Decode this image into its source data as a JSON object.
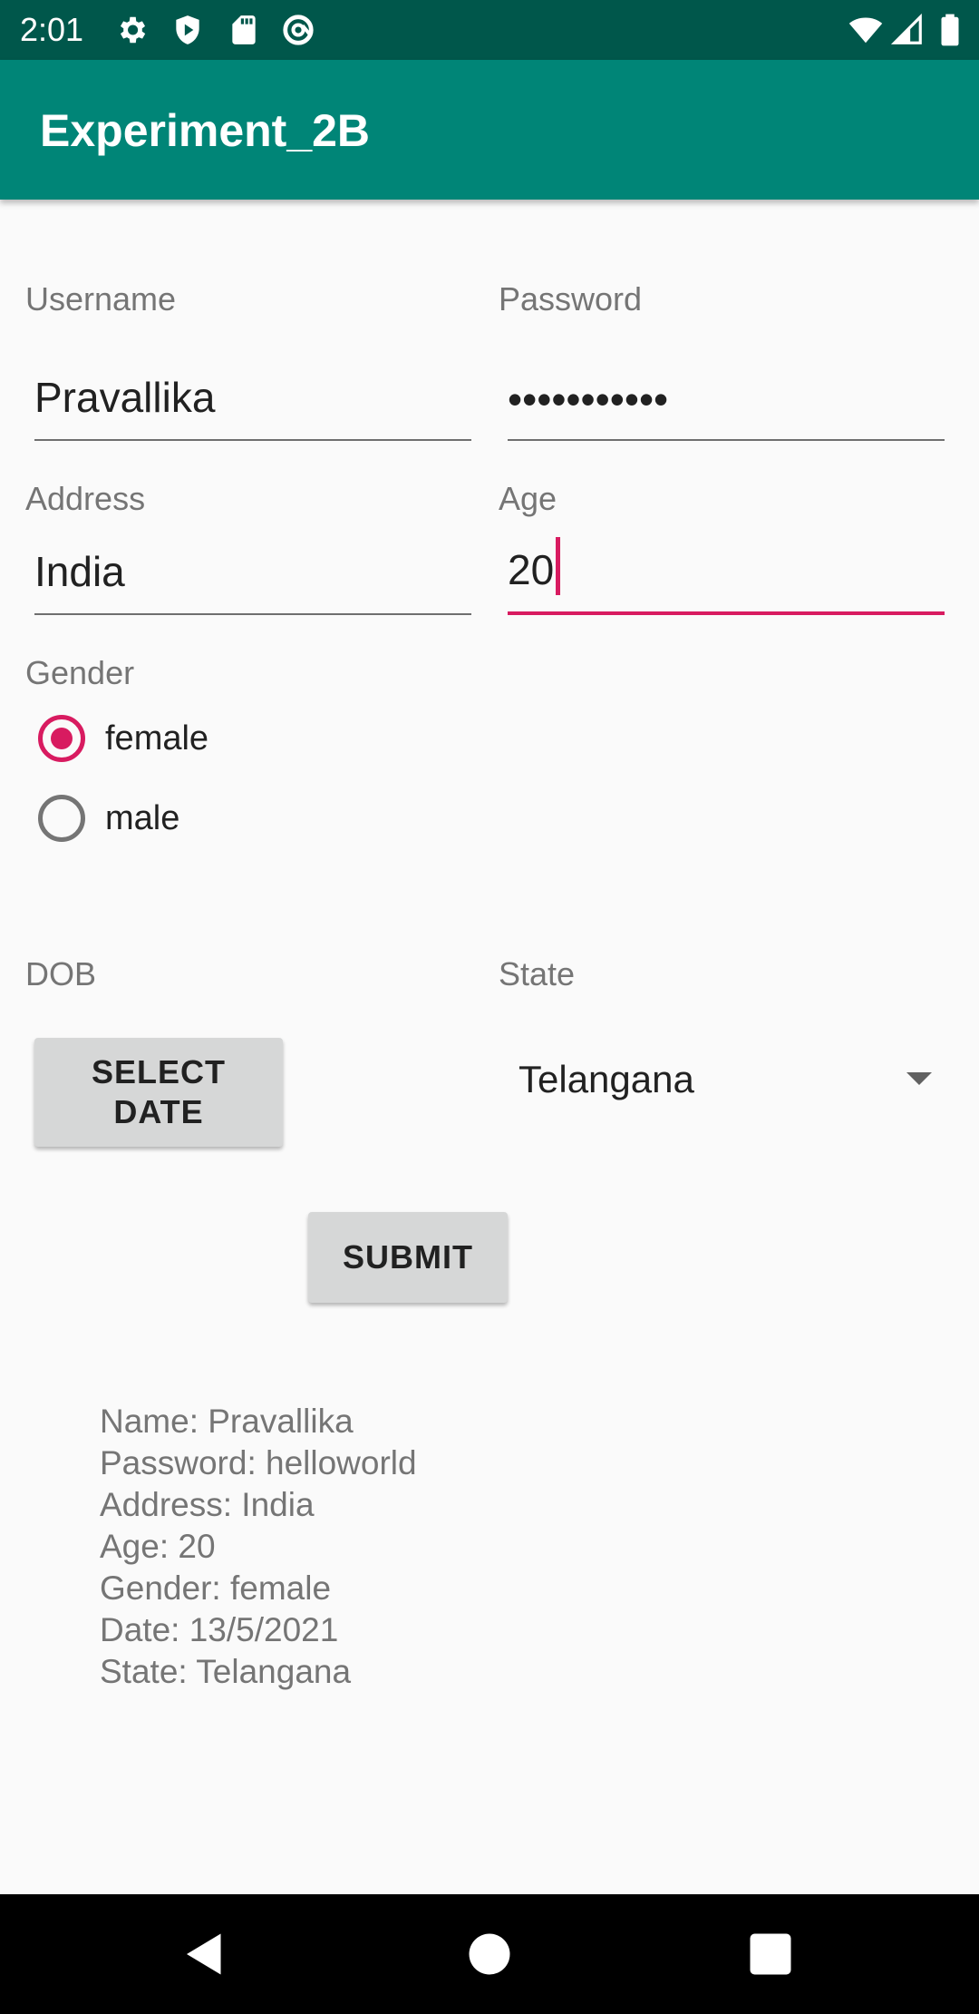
{
  "status_bar": {
    "time": "2:01",
    "icons": [
      "settings-icon",
      "shield-icon",
      "sd-card-icon",
      "at-sign-icon",
      "wifi-icon",
      "signal-icon",
      "battery-icon"
    ]
  },
  "app_bar": {
    "title": "Experiment_2B",
    "color": "#008577"
  },
  "form": {
    "username": {
      "label": "Username",
      "value": "Pravallika"
    },
    "password": {
      "label": "Password",
      "value": "•••••••••••"
    },
    "address": {
      "label": "Address",
      "value": "India"
    },
    "age": {
      "label": "Age",
      "value": "20"
    },
    "gender": {
      "label": "Gender",
      "options": [
        {
          "label": "female",
          "checked": true
        },
        {
          "label": "male",
          "checked": false
        }
      ]
    },
    "dob": {
      "label": "DOB",
      "button_label": "SELECT\nDATE"
    },
    "state": {
      "label": "State",
      "selected": "Telangana"
    },
    "submit_label": "SUBMIT",
    "accent_color": "#d81b60"
  },
  "result": {
    "lines": [
      "Name: Pravallika",
      "Password: helloworld",
      "Address: India",
      "Age: 20",
      "Gender: female",
      "Date: 13/5/2021",
      "State: Telangana"
    ]
  },
  "nav_bar": {
    "buttons": [
      "back-icon",
      "home-icon",
      "recents-icon"
    ]
  }
}
